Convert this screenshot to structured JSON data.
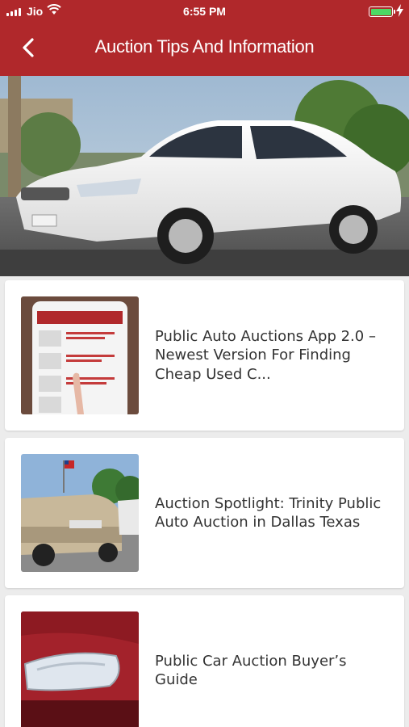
{
  "status_bar": {
    "carrier": "Jio",
    "time": "6:55 PM",
    "battery_level": 1.0
  },
  "header": {
    "title": "Auction Tips And Information",
    "back_icon": "chevron-left-icon",
    "background_color": "#b0282b"
  },
  "hero_image": "white-sedan-photo",
  "articles": [
    {
      "title": "Public Auto Auctions App 2.0 – Newest Version For Finding Cheap Used C...",
      "thumbnail": "phone-app-screenshot"
    },
    {
      "title": "Auction Spotlight: Trinity Public Auto Auction in Dallas Texas",
      "thumbnail": "car-lot-photo"
    },
    {
      "title": "Public Car Auction Buyer’s Guide",
      "thumbnail": "red-car-headlight-photo"
    }
  ]
}
